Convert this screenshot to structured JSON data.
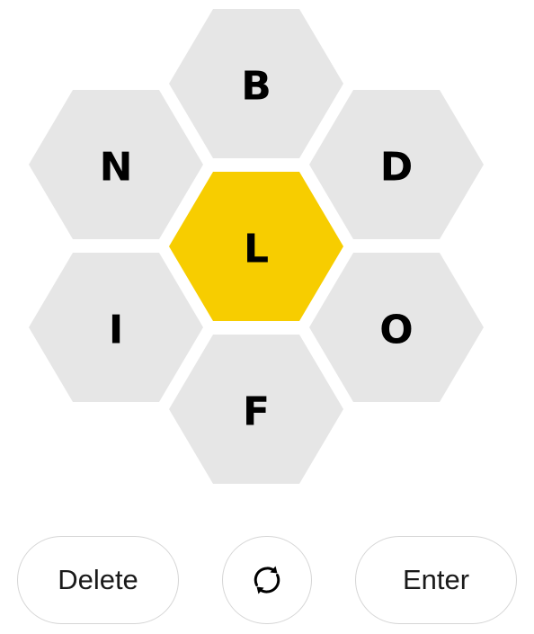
{
  "hive": {
    "center": "L",
    "top": "B",
    "upper_left": "N",
    "upper_right": "D",
    "lower_left": "I",
    "lower_right": "O",
    "bottom": "F"
  },
  "colors": {
    "center_cell": "#f7cd00",
    "outer_cell": "#e6e6e6",
    "letter": "#000000"
  },
  "controls": {
    "delete_label": "Delete",
    "shuffle_icon": "shuffle-icon",
    "enter_label": "Enter"
  }
}
